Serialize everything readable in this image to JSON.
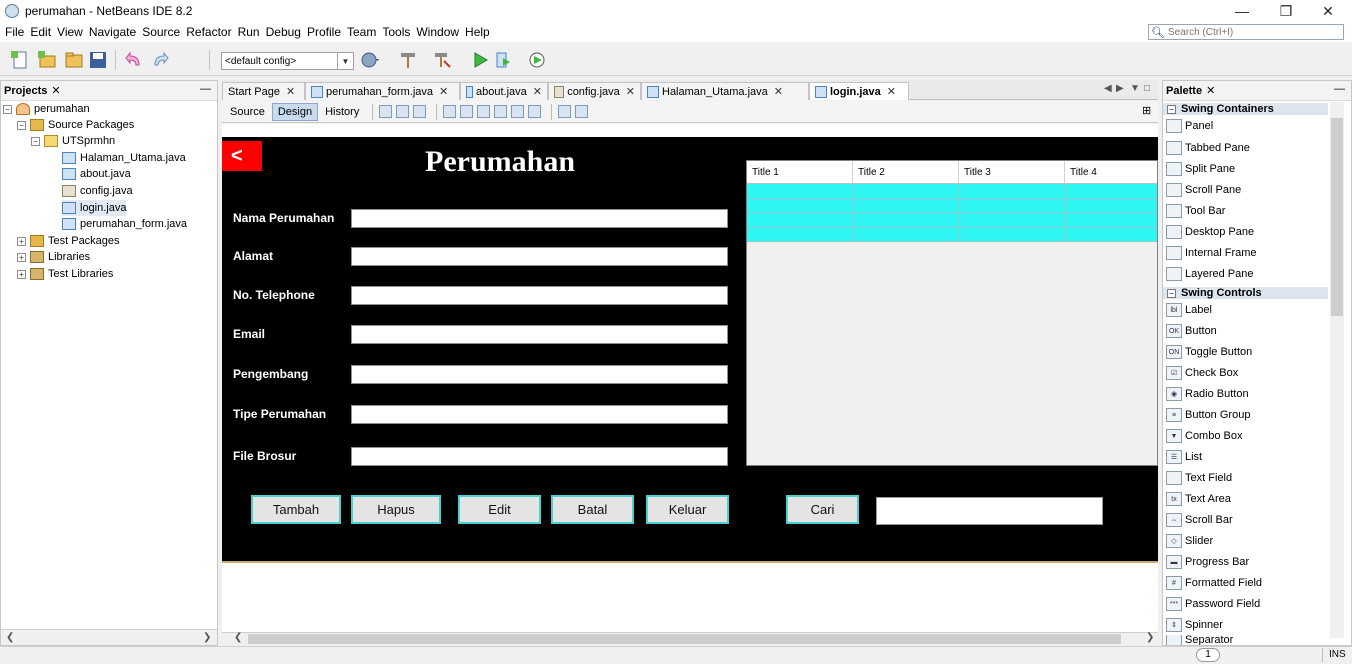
{
  "window": {
    "title": "perumahan - NetBeans IDE 8.2"
  },
  "menu": [
    "File",
    "Edit",
    "View",
    "Navigate",
    "Source",
    "Refactor",
    "Run",
    "Debug",
    "Profile",
    "Team",
    "Tools",
    "Window",
    "Help"
  ],
  "search": {
    "placeholder": "Search (Ctrl+I)"
  },
  "toolbar": {
    "config": "<default config>"
  },
  "projects": {
    "title": "Projects",
    "tree": [
      {
        "label": "perumahan",
        "icon": "project-icon"
      },
      {
        "label": "Source Packages",
        "icon": "source-packages-icon"
      },
      {
        "label": "UTSprmhn",
        "icon": "package-icon"
      },
      {
        "label": "Halaman_Utama.java",
        "icon": "java-form-icon"
      },
      {
        "label": "about.java",
        "icon": "java-form-icon"
      },
      {
        "label": "config.java",
        "icon": "java-class-icon"
      },
      {
        "label": "login.java",
        "icon": "java-form-icon"
      },
      {
        "label": "perumahan_form.java",
        "icon": "java-form-icon"
      },
      {
        "label": "Test Packages",
        "icon": "test-packages-icon"
      },
      {
        "label": "Libraries",
        "icon": "libraries-icon"
      },
      {
        "label": "Test Libraries",
        "icon": "test-libraries-icon"
      }
    ]
  },
  "editor": {
    "tabs": [
      "Start Page",
      "perumahan_form.java",
      "about.java",
      "config.java",
      "Halaman_Utama.java",
      "login.java"
    ],
    "active_tab": "login.java",
    "views": [
      "Source",
      "Design",
      "History"
    ],
    "active_view": "Design"
  },
  "form": {
    "back_label": "<",
    "title": "Perumahan",
    "fields": [
      {
        "label": "Nama Perumahan",
        "value": ""
      },
      {
        "label": "Alamat",
        "value": ""
      },
      {
        "label": "No. Telephone",
        "value": ""
      },
      {
        "label": "Email",
        "value": ""
      },
      {
        "label": "Pengembang",
        "value": ""
      },
      {
        "label": "Tipe Perumahan",
        "value": ""
      },
      {
        "label": "File Brosur",
        "value": ""
      }
    ],
    "table": {
      "columns": [
        "Title 1",
        "Title 2",
        "Title 3",
        "Title 4"
      ],
      "rows": [
        [
          "",
          "",
          "",
          ""
        ],
        [
          "",
          "",
          "",
          ""
        ],
        [
          "",
          "",
          "",
          ""
        ],
        [
          "",
          "",
          "",
          ""
        ]
      ]
    },
    "buttons": [
      "Tambah",
      "Hapus",
      "Edit",
      "Batal",
      "Keluar"
    ],
    "search_button": "Cari",
    "search_value": "",
    "colors": {
      "canvas": "#000000",
      "back_button": "#ff0000",
      "table_rows": "#2ff5f3",
      "button_border": "#4bd0d0"
    }
  },
  "palette": {
    "title": "Palette",
    "categories": [
      {
        "name": "Swing Containers",
        "items": [
          {
            "label": "Panel",
            "icon": "panel-icon"
          },
          {
            "label": "Tabbed Pane",
            "icon": "tabbed-pane-icon"
          },
          {
            "label": "Split Pane",
            "icon": "split-pane-icon"
          },
          {
            "label": "Scroll Pane",
            "icon": "scroll-pane-icon"
          },
          {
            "label": "Tool Bar",
            "icon": "tool-bar-icon"
          },
          {
            "label": "Desktop Pane",
            "icon": "desktop-pane-icon"
          },
          {
            "label": "Internal Frame",
            "icon": "internal-frame-icon"
          },
          {
            "label": "Layered Pane",
            "icon": "layered-pane-icon"
          }
        ]
      },
      {
        "name": "Swing Controls",
        "items": [
          {
            "label": "Label",
            "icon": "label-icon"
          },
          {
            "label": "Button",
            "icon": "button-icon"
          },
          {
            "label": "Toggle Button",
            "icon": "toggle-button-icon"
          },
          {
            "label": "Check Box",
            "icon": "check-box-icon"
          },
          {
            "label": "Radio Button",
            "icon": "radio-button-icon"
          },
          {
            "label": "Button Group",
            "icon": "button-group-icon"
          },
          {
            "label": "Combo Box",
            "icon": "combo-box-icon"
          },
          {
            "label": "List",
            "icon": "list-icon"
          },
          {
            "label": "Text Field",
            "icon": "text-field-icon"
          },
          {
            "label": "Text Area",
            "icon": "text-area-icon"
          },
          {
            "label": "Scroll Bar",
            "icon": "scroll-bar-icon"
          },
          {
            "label": "Slider",
            "icon": "slider-icon"
          },
          {
            "label": "Progress Bar",
            "icon": "progress-bar-icon"
          },
          {
            "label": "Formatted Field",
            "icon": "formatted-field-icon"
          },
          {
            "label": "Password Field",
            "icon": "password-field-icon"
          },
          {
            "label": "Spinner",
            "icon": "spinner-icon"
          },
          {
            "label": "Separator",
            "icon": "separator-icon"
          }
        ]
      }
    ]
  },
  "status": {
    "notifications": "1",
    "mode": "INS"
  }
}
